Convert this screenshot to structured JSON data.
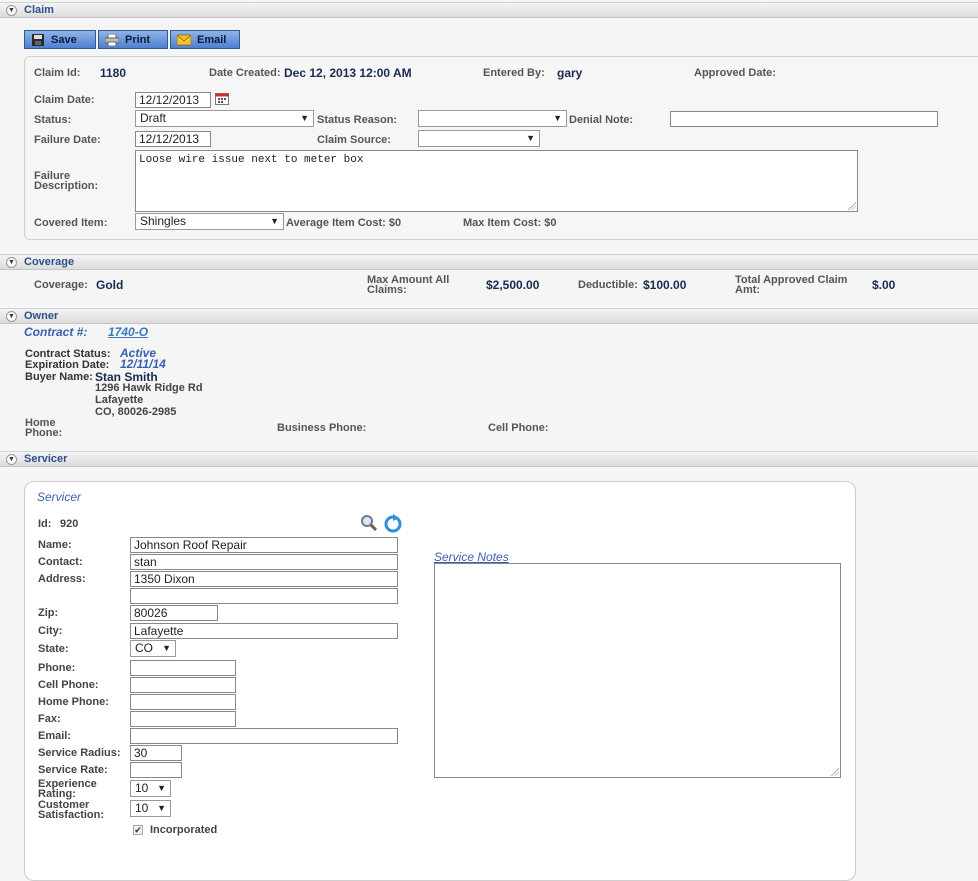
{
  "claim_section": {
    "title": "Claim",
    "toolbar": {
      "save": "Save",
      "print": "Print",
      "email": "Email"
    },
    "claim_id_label": "Claim Id:",
    "claim_id": "1180",
    "date_created_label": "Date Created:",
    "date_created": "Dec 12, 2013 12:00 AM",
    "entered_by_label": "Entered By:",
    "entered_by": "gary",
    "approved_date_label": "Approved Date:",
    "claim_date_label": "Claim Date:",
    "claim_date": "12/12/2013",
    "status_label": "Status:",
    "status": "Draft",
    "status_reason_label": "Status Reason:",
    "status_reason": "",
    "denial_note_label": "Denial Note:",
    "denial_note": "",
    "failure_date_label": "Failure Date:",
    "failure_date": "12/12/2013",
    "claim_source_label": "Claim Source:",
    "claim_source": "",
    "failure_description_label_1": "Failure",
    "failure_description_label_2": "Description:",
    "failure_description": "Loose wire issue next to meter box",
    "covered_item_label": "Covered Item:",
    "covered_item": "Shingles",
    "avg_item_cost": "Average Item Cost: $0",
    "max_item_cost": "Max Item Cost: $0"
  },
  "coverage_section": {
    "title": "Coverage",
    "coverage_label": "Coverage:",
    "coverage": "Gold",
    "max_amount_label_1": "Max Amount All",
    "max_amount_label_2": "Claims:",
    "max_amount": "$2,500.00",
    "deductible_label": "Deductible:",
    "deductible": "$100.00",
    "total_approved_label_1": "Total Approved Claim",
    "total_approved_label_2": "Amt:",
    "total_approved": "$.00"
  },
  "owner_section": {
    "title": "Owner",
    "contract_label": "Contract #:",
    "contract": "1740-O",
    "contract_status_label": "Contract Status:",
    "contract_status": "Active",
    "expiration_label": "Expiration Date:",
    "expiration": "12/11/14",
    "buyer_name_label": "Buyer Name:",
    "buyer_name": "Stan Smith",
    "address_1": "1296 Hawk Ridge Rd",
    "address_2": "Lafayette",
    "address_3": "CO,  80026-2985",
    "home_phone_label_1": "Home",
    "home_phone_label_2": "Phone:",
    "business_phone_label": "Business Phone:",
    "cell_phone_label": "Cell Phone:"
  },
  "servicer_section": {
    "title": "Servicer",
    "panel_title": "Servicer",
    "id_label": "Id:",
    "id": "920",
    "name_label": "Name:",
    "name": "Johnson Roof Repair",
    "contact_label": "Contact:",
    "contact": "stan",
    "address_label": "Address:",
    "address": "1350 Dixon",
    "address2": "",
    "zip_label": "Zip:",
    "zip": "80026",
    "city_label": "City:",
    "city": "Lafayette",
    "state_label": "State:",
    "state": "CO",
    "phone_label": "Phone:",
    "cell_phone_label": "Cell Phone:",
    "home_phone_label": "Home Phone:",
    "fax_label": "Fax:",
    "email_label": "Email:",
    "service_radius_label": "Service Radius:",
    "service_radius": "30",
    "service_rate_label": "Service Rate:",
    "experience_label_1": "Experience",
    "experience_label_2": "Rating:",
    "experience": "10",
    "satisfaction_label_1": "Customer",
    "satisfaction_label_2": "Satisfaction:",
    "satisfaction": "10",
    "incorporated_label": "Incorporated",
    "incorporated_checked": true,
    "service_notes_label": "Service Notes",
    "service_notes": ""
  }
}
